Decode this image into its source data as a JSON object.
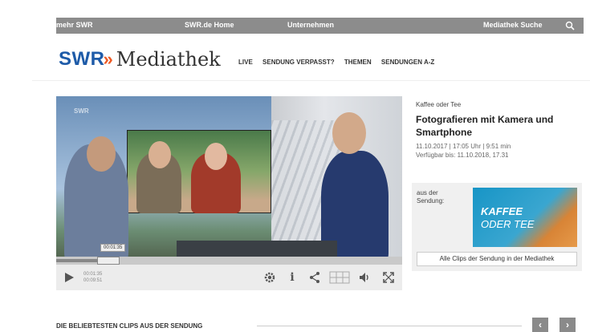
{
  "topbar": {
    "items": [
      "mehr SWR",
      "SWR.de Home",
      "Unternehmen",
      "Mediathek Suche"
    ]
  },
  "brand": {
    "logo": "SWR",
    "arrows": "»",
    "name": "Mediathek"
  },
  "nav": {
    "items": [
      "LIVE",
      "SENDUNG VERPASST?",
      "THEMEN",
      "SENDUNGEN A-Z"
    ]
  },
  "player": {
    "watermark": "SWR",
    "progress_fraction": 0.15,
    "tooltip": "00:01:35",
    "time_current": "00:01:35",
    "time_total": "00:09:51"
  },
  "info": {
    "kicker": "Kaffee oder Tee",
    "title": "Fotografieren mit Kamera und Smartphone",
    "meta_line1": "11.10.2017 | 17:05 Uhr | 9:51 min",
    "meta_line2": "Verfügbar bis: 11.10.2018, 17.31"
  },
  "sendung": {
    "label": "aus der Sendung:",
    "kaffee_line1": "KAFFEE",
    "kaffee_line2": "ODER TEE",
    "clips_button": "Alle Clips der Sendung in der Mediathek"
  },
  "section": {
    "title": "DIE BELIEBTESTEN CLIPS AUS DER SENDUNG",
    "prev": "‹",
    "next": "›"
  },
  "colors": {
    "swr_blue": "#1e5ba8",
    "swr_orange": "#ee5a24",
    "topbar": "#8c8c8c"
  }
}
